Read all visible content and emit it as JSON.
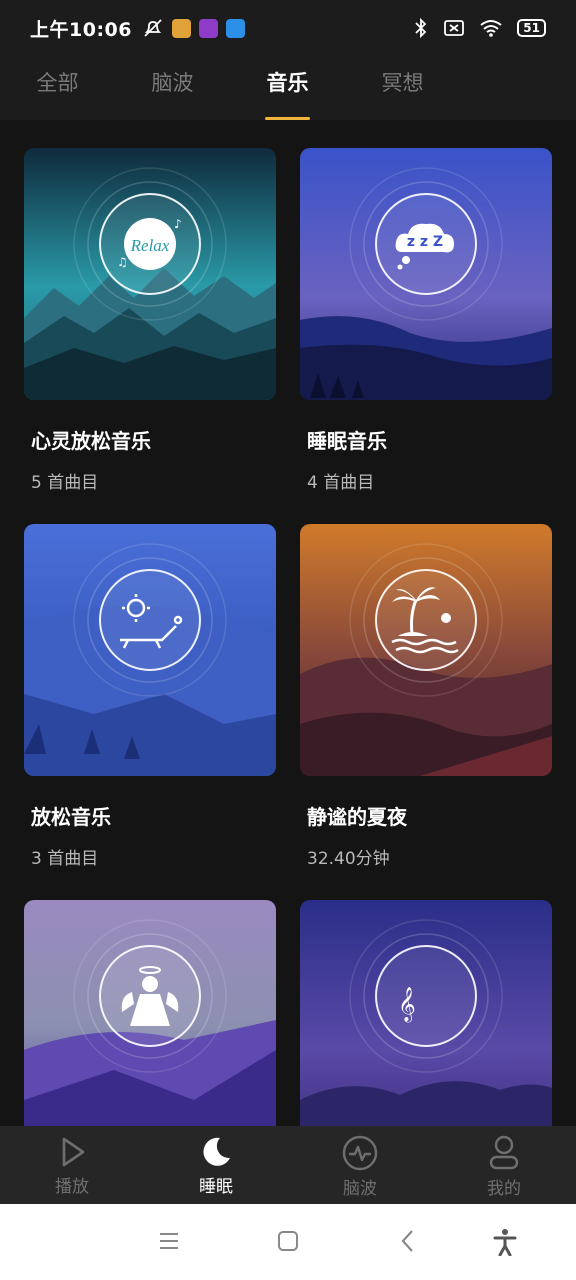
{
  "status_bar": {
    "time": "上午10:06",
    "battery": "51",
    "app_colors": [
      "#e2a23a",
      "#8e3cc8",
      "#2c8fe8"
    ]
  },
  "tabs": [
    {
      "label": "全部",
      "active": false
    },
    {
      "label": "脑波",
      "active": false
    },
    {
      "label": "音乐",
      "active": true
    },
    {
      "label": "冥想",
      "active": false
    }
  ],
  "cards": [
    {
      "title": "心灵放松音乐",
      "subtitle": "5 首曲目",
      "icon": "relax-badge-icon",
      "badge_text": "Relax"
    },
    {
      "title": "睡眠音乐",
      "subtitle": "4 首曲目",
      "icon": "sleep-cloud-icon",
      "badge_text": "z z Z"
    },
    {
      "title": "放松音乐",
      "subtitle": "3 首曲目",
      "icon": "sunbed-icon"
    },
    {
      "title": "静谧的夏夜",
      "subtitle": "32.40分钟",
      "icon": "palm-island-icon"
    },
    {
      "title": "",
      "subtitle": "",
      "icon": "angel-icon"
    },
    {
      "title": "",
      "subtitle": "",
      "icon": "moon-music-icon"
    }
  ],
  "bottom_nav": [
    {
      "label": "播放",
      "icon": "play-icon",
      "active": false
    },
    {
      "label": "睡眠",
      "icon": "moon-icon",
      "active": true
    },
    {
      "label": "脑波",
      "icon": "pulse-icon",
      "active": false
    },
    {
      "label": "我的",
      "icon": "person-icon",
      "active": false
    }
  ],
  "colors": {
    "accent": "#f2b43a",
    "background": "#141414",
    "tab_bar": "#1c1c1c",
    "nav_bar": "#262626"
  }
}
